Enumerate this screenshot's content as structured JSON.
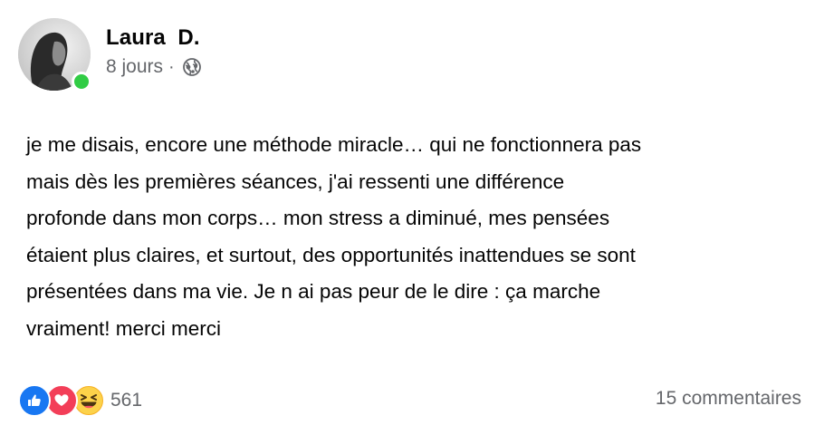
{
  "author": {
    "name": "Laura  D.",
    "online": true,
    "online_color": "#31cc45"
  },
  "meta": {
    "time": "8 jours",
    "separator": "·",
    "privacy_icon": "globe-icon"
  },
  "post": {
    "text": "je me disais, encore une méthode miracle… qui ne fonctionnera pas\nmais dès les premières séances, j'ai ressenti une différence\nprofonde dans mon corps… mon stress a diminué, mes pensées\nétaient plus claires, et surtout, des opportunités inattendues se sont\nprésentées dans ma vie. Je n ai pas peur de le dire : ça marche\nvraiment! merci merci"
  },
  "footer": {
    "reactions": [
      {
        "type": "like",
        "icon": "thumbs-up-icon",
        "color": "#1877f2"
      },
      {
        "type": "love",
        "icon": "heart-icon",
        "color": "#f33e58"
      },
      {
        "type": "haha",
        "icon": "laughing-face-icon",
        "color": "#f7b125"
      }
    ],
    "reaction_count": "561",
    "comments_label": "15 commentaires"
  }
}
